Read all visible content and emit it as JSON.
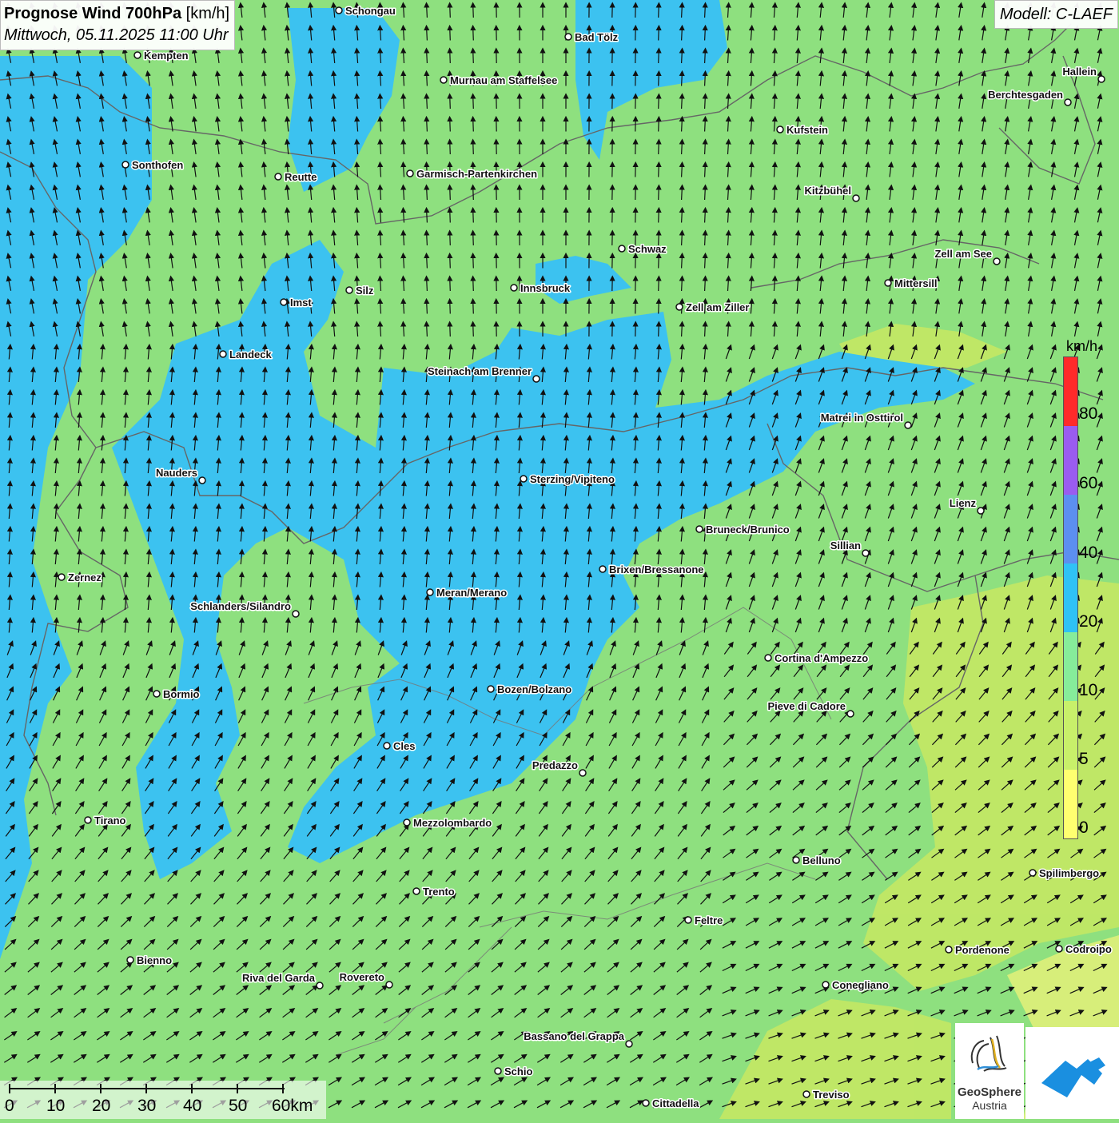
{
  "header": {
    "title_bold": "Prognose Wind 700hPa",
    "title_unit": "[km/h]",
    "datetime": "Mittwoch, 05.11.2025 11:00 Uhr"
  },
  "model_label": "Modell: C-LAEF",
  "legend": {
    "unit": "km/h",
    "ticks": [
      "80",
      "60",
      "40",
      "20",
      "10",
      "5",
      "0"
    ],
    "colors": [
      "#ff2a2a",
      "#9a5cf0",
      "#5c8ff0",
      "#2fc2f5",
      "#86ec9a",
      "#c8f06a",
      "#ffff70"
    ]
  },
  "scalebar": {
    "labels": [
      "0",
      "10",
      "20",
      "30",
      "40",
      "50",
      "60km"
    ]
  },
  "logo": {
    "line1": "GeoSphere",
    "line2": "Austria"
  },
  "cities": [
    {
      "name": "Schongau"
    },
    {
      "name": "Bad Tölz"
    },
    {
      "name": "Kempten"
    },
    {
      "name": "Murnau am Staffelsee"
    },
    {
      "name": "Hallein"
    },
    {
      "name": "Berchtesgaden"
    },
    {
      "name": "Kufstein"
    },
    {
      "name": "Sonthofen"
    },
    {
      "name": "Reutte"
    },
    {
      "name": "Garmisch-Partenkirchen"
    },
    {
      "name": "Kitzbühel"
    },
    {
      "name": "Schwaz"
    },
    {
      "name": "Zell am See"
    },
    {
      "name": "Mittersill"
    },
    {
      "name": "Imst"
    },
    {
      "name": "Silz"
    },
    {
      "name": "Innsbruck"
    },
    {
      "name": "Zell am Ziller"
    },
    {
      "name": "Landeck"
    },
    {
      "name": "Steinach am Brenner"
    },
    {
      "name": "Matrei in Osttirol"
    },
    {
      "name": "Nauders"
    },
    {
      "name": "Sterzing/Vipiteno"
    },
    {
      "name": "Lienz"
    },
    {
      "name": "Bruneck/Brunico"
    },
    {
      "name": "Sillian"
    },
    {
      "name": "Zernez"
    },
    {
      "name": "Brixen/Bressanone"
    },
    {
      "name": "Meran/Merano"
    },
    {
      "name": "Schlanders/Silandro"
    },
    {
      "name": "Cortina d'Ampezzo"
    },
    {
      "name": "Bormio"
    },
    {
      "name": "Bozen/Bolzano"
    },
    {
      "name": "Pieve di Cadore"
    },
    {
      "name": "Cles"
    },
    {
      "name": "Predazzo"
    },
    {
      "name": "Tirano"
    },
    {
      "name": "Mezzolombardo"
    },
    {
      "name": "Belluno"
    },
    {
      "name": "Spilimbergo"
    },
    {
      "name": "Trento"
    },
    {
      "name": "Feltre"
    },
    {
      "name": "Pordenone"
    },
    {
      "name": "Codroipo"
    },
    {
      "name": "Bienno"
    },
    {
      "name": "Riva del Garda"
    },
    {
      "name": "Rovereto"
    },
    {
      "name": "Conegliano"
    },
    {
      "name": "Bassano del Grappa"
    },
    {
      "name": "Schio"
    },
    {
      "name": "Treviso"
    },
    {
      "name": "Cittadella"
    }
  ]
}
